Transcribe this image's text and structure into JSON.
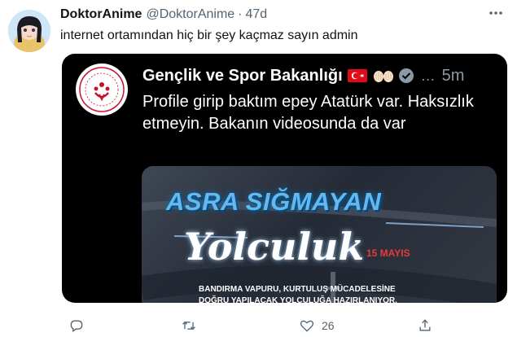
{
  "tweet": {
    "name": "DoktorAnime",
    "handle": "@DoktorAnime",
    "separator": "·",
    "time": "47d",
    "text": "internet ortamından hiç bir şey kaçmaz sayın admin"
  },
  "quoted": {
    "name": "Gençlik ve Spor Bakanlığı",
    "more": "…",
    "time": "5m",
    "text": "Profile girip baktım epey Atatürk var. Haksızlık etmeyin. Bakanın videosunda da var",
    "media": {
      "title": "ASRA SIĞMAYAN",
      "script": "Yolculuk",
      "date": "15 MAYIS",
      "line1": "BANDIRMA VAPURU, KURTULUŞ MÜCADELESİNE",
      "line2": "DOĞRU YAPILACAK YOLCULUĞA HAZIRLANIYOR."
    }
  },
  "actions": {
    "like_count": "26"
  },
  "icons": [
    "avatar",
    "more-icon",
    "turkish-flag-icon",
    "raised-hands-icon",
    "verified-icon",
    "reply-icon",
    "retweet-icon",
    "like-icon",
    "share-icon"
  ],
  "colors": {
    "muted": "#536471",
    "flag_red": "#e30a17"
  }
}
